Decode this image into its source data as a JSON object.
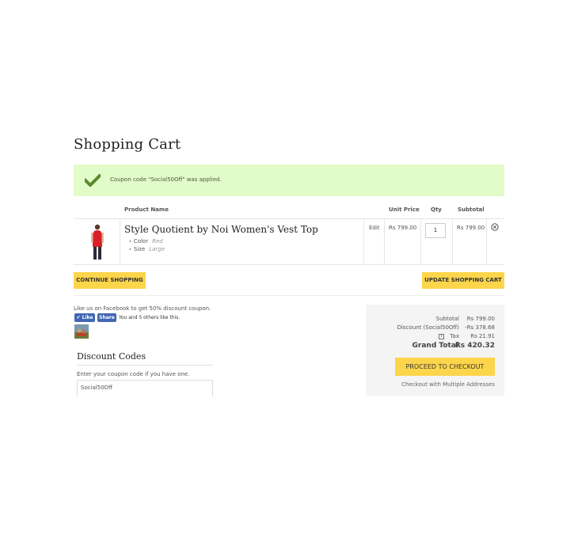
{
  "page": {
    "title": "Shopping Cart"
  },
  "message": {
    "text": "Coupon code \"Social50Off\" was applied."
  },
  "table": {
    "headers": {
      "product": "Product Name",
      "unit_price": "Unit Price",
      "qty": "Qty",
      "subtotal": "Subtotal"
    },
    "rows": [
      {
        "name": "Style Quotient by Noi Women's Vest Top",
        "options": [
          {
            "label": "Color",
            "value": "Red"
          },
          {
            "label": "Size",
            "value": "Large"
          }
        ],
        "edit": "Edit",
        "unit_price": "Rs 799.00",
        "qty": "1",
        "subtotal": "Rs 799.00"
      }
    ]
  },
  "buttons": {
    "continue": "CONTINUE SHOPPING",
    "update": "UPDATE SHOPPING CART"
  },
  "facebook": {
    "text": "Like us on Facebook to get 50% discount coupon.",
    "like": "Like",
    "share": "Share",
    "count": "You and 5 others like this."
  },
  "discount": {
    "title": "Discount Codes",
    "label": "Enter your coupon code if you have one.",
    "value": "Social50Off"
  },
  "totals": {
    "subtotal_label": "Subtotal",
    "subtotal_value": "Rs 799.00",
    "discount_label": "Discount (Social50Off)",
    "discount_value": "-Rs 378.68",
    "tax_label": "Tax",
    "tax_value": "Rs 21.91",
    "grand_label": "Grand Total",
    "grand_value": "Rs 420.32",
    "checkout": "PROCEED TO CHECKOUT",
    "multi": "Checkout with Multiple Addresses"
  }
}
